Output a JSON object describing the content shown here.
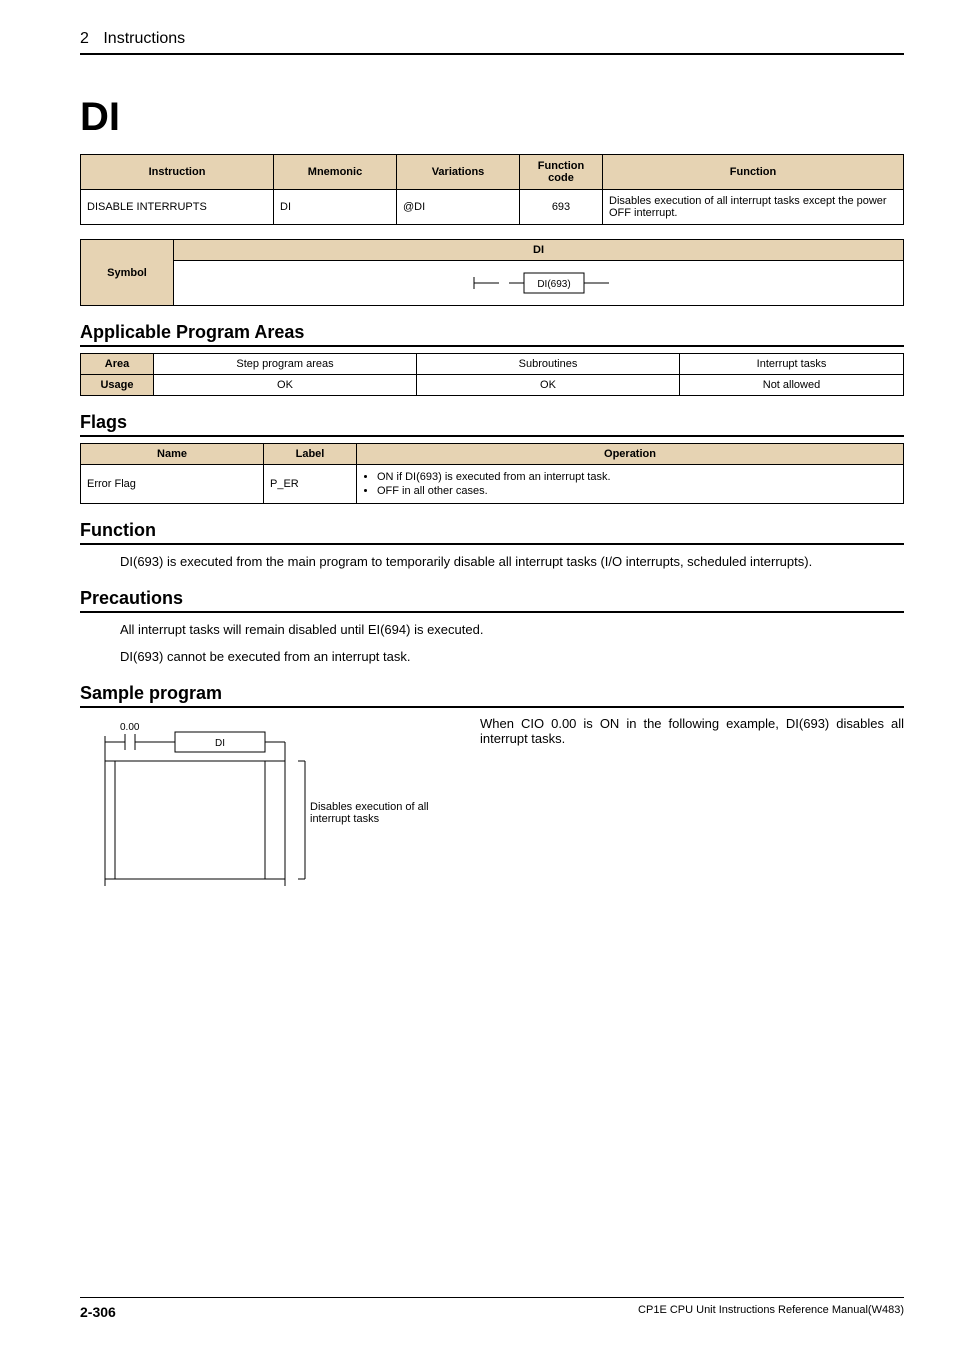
{
  "header": {
    "chapter": "2",
    "chapterTitle": "Instructions"
  },
  "title": "DI",
  "mainTable": {
    "headers": [
      "Instruction",
      "Mnemonic",
      "Variations",
      "Function code",
      "Function"
    ],
    "row": {
      "instruction": "DISABLE INTERRUPTS",
      "mnemonic": "DI",
      "variations": "@DI",
      "code": "693",
      "function": "Disables execution of all interrupt tasks except the power OFF interrupt."
    }
  },
  "symbolTable": {
    "sideLabel": "Symbol",
    "header": "DI",
    "boxLabel": "DI(693)"
  },
  "sections": {
    "areas": "Applicable Program Areas",
    "flags": "Flags",
    "function": "Function",
    "precautions": "Precautions",
    "sample": "Sample program"
  },
  "areasTable": {
    "areaLabel": "Area",
    "usageLabel": "Usage",
    "cols": [
      "Step program areas",
      "Subroutines",
      "Interrupt tasks"
    ],
    "vals": [
      "OK",
      "OK",
      "Not allowed"
    ]
  },
  "flagsTable": {
    "headers": [
      "Name",
      "Label",
      "Operation"
    ],
    "row": {
      "name": "Error Flag",
      "label": "P_ER",
      "ops": [
        "ON if DI(693) is executed from an interrupt task.",
        "OFF in all other cases."
      ]
    }
  },
  "functionText": "DI(693) is executed from the main program to temporarily disable all interrupt tasks (I/O interrupts, scheduled interrupts).",
  "precautions": [
    "All interrupt tasks will remain disabled until EI(694) is executed.",
    "DI(693) cannot be executed from an interrupt task."
  ],
  "sample": {
    "contactLabel": "0.00",
    "boxLabel": "DI",
    "note": "Disables execution of all interrupt tasks",
    "text": "When CIO 0.00 is ON in the following example, DI(693) disables all interrupt tasks."
  },
  "footer": {
    "page": "2-306",
    "doc": "CP1E CPU Unit Instructions Reference Manual(W483)"
  }
}
